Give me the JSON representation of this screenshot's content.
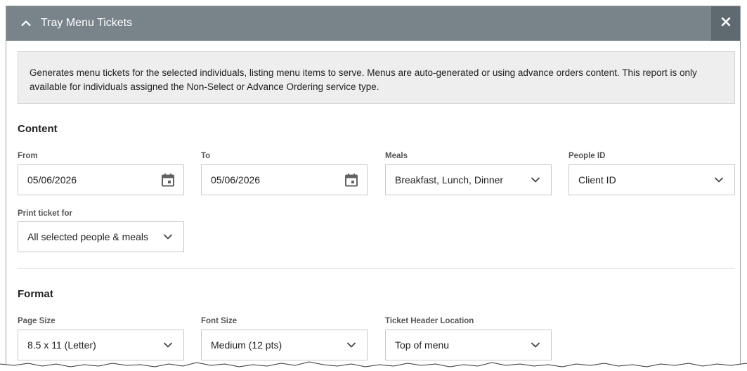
{
  "dialog": {
    "title": "Tray Menu Tickets",
    "description": "Generates menu tickets for the selected individuals, listing menu items to serve. Menus are auto-generated or using advance orders content. This report is only available for individuals assigned the Non-Select or Advance Ordering service type."
  },
  "content": {
    "heading": "Content",
    "from": {
      "label": "From",
      "value": "05/06/2026",
      "icon": "calendar-icon"
    },
    "to": {
      "label": "To",
      "value": "05/06/2026",
      "icon": "calendar-icon"
    },
    "meals": {
      "label": "Meals",
      "value": "Breakfast, Lunch, Dinner",
      "icon": "chevron-down-icon"
    },
    "people_id": {
      "label": "People ID",
      "value": "Client ID",
      "icon": "chevron-down-icon"
    },
    "print_ticket_for": {
      "label": "Print ticket for",
      "value": "All selected people & meals",
      "icon": "chevron-down-icon"
    }
  },
  "format": {
    "heading": "Format",
    "page_size": {
      "label": "Page Size",
      "value": "8.5 x 11 (Letter)"
    },
    "font_size": {
      "label": "Font Size",
      "value": "Medium (12 pts)"
    },
    "ticket_header_location": {
      "label": "Ticket Header Location",
      "value": "Top of menu"
    }
  },
  "colors": {
    "titlebar": "#78848a",
    "close_button": "#5f6a70",
    "info_background": "#eeeeee"
  }
}
